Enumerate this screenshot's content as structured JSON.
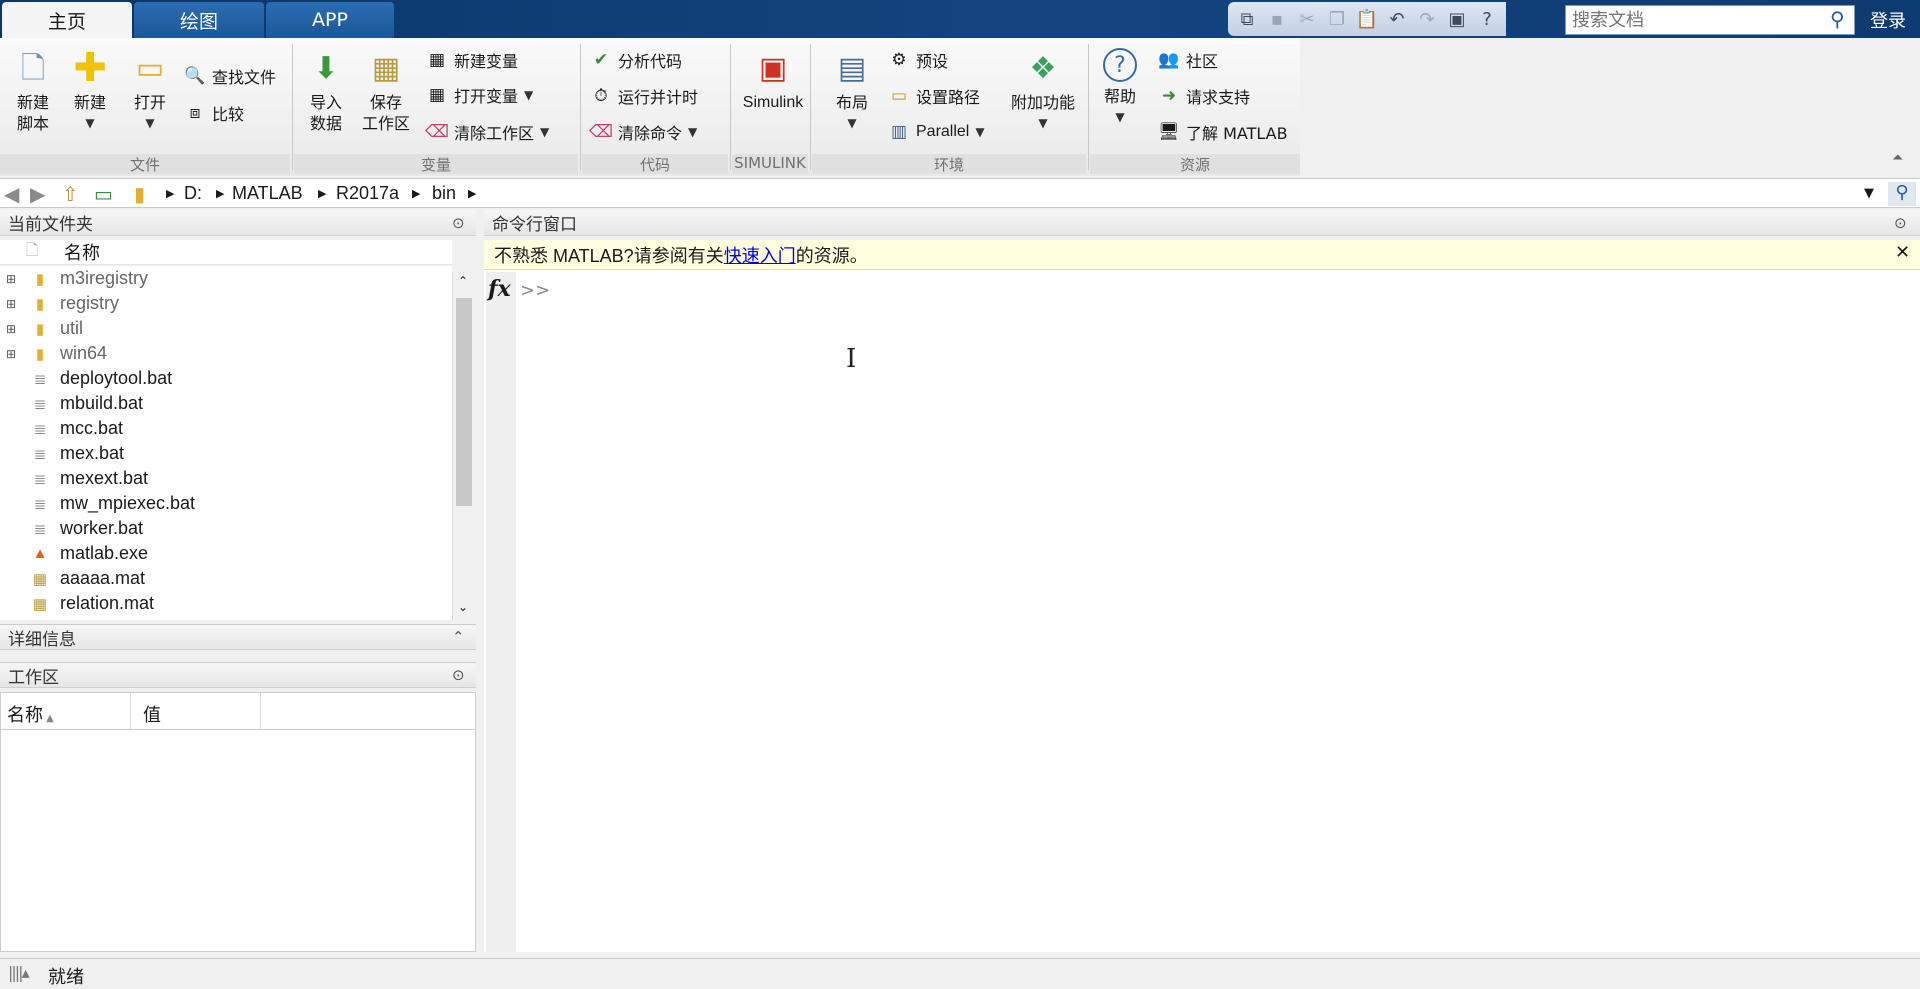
{
  "tabs": [
    {
      "label": "主页"
    },
    {
      "label": "绘图"
    },
    {
      "label": "APP"
    }
  ],
  "search": {
    "placeholder": "搜索文档"
  },
  "login_label": "登录",
  "ribbon": {
    "file": {
      "new_script": "新建\n脚本",
      "new": "新建",
      "open": "打开",
      "find_files": "查找文件",
      "compare": "比较",
      "group": "文件"
    },
    "variable": {
      "import": "导入\n数据",
      "save_ws": "保存\n工作区",
      "new_var": "新建变量",
      "open_var": "打开变量",
      "clear_ws": "清除工作区",
      "group": "变量"
    },
    "code": {
      "analyze": "分析代码",
      "run_time": "运行并计时",
      "clear_cmd": "清除命令",
      "group": "代码"
    },
    "simulink": {
      "label": "Simulink",
      "group": "SIMULINK"
    },
    "env": {
      "layout": "布局",
      "prefs": "预设",
      "set_path": "设置路径",
      "parallel": "Parallel",
      "addons": "附加功能",
      "group": "环境"
    },
    "resources": {
      "help": "帮助",
      "community": "社区",
      "request_support": "请求支持",
      "learn": "了解 MATLAB",
      "group": "资源"
    }
  },
  "path": [
    "D:",
    "MATLAB",
    "R2017a",
    "bin"
  ],
  "current_folder": {
    "title": "当前文件夹",
    "col_name": "名称",
    "items": [
      {
        "name": "m3iregistry",
        "type": "folder"
      },
      {
        "name": "registry",
        "type": "folder"
      },
      {
        "name": "util",
        "type": "folder"
      },
      {
        "name": "win64",
        "type": "folder"
      },
      {
        "name": "deploytool.bat",
        "type": "bat"
      },
      {
        "name": "mbuild.bat",
        "type": "bat"
      },
      {
        "name": "mcc.bat",
        "type": "bat"
      },
      {
        "name": "mex.bat",
        "type": "bat"
      },
      {
        "name": "mexext.bat",
        "type": "bat"
      },
      {
        "name": "mw_mpiexec.bat",
        "type": "bat"
      },
      {
        "name": "worker.bat",
        "type": "bat"
      },
      {
        "name": "matlab.exe",
        "type": "exe"
      },
      {
        "name": "aaaaa.mat",
        "type": "mat"
      },
      {
        "name": "relation.mat",
        "type": "mat"
      }
    ]
  },
  "details": {
    "title": "详细信息"
  },
  "workspace": {
    "title": "工作区",
    "col_name": "名称",
    "col_value": "值"
  },
  "command_window": {
    "title": "命令行窗口",
    "notice_prefix": "不熟悉 MATLAB?请参阅有关",
    "notice_link": "快速入门",
    "notice_suffix": "的资源。",
    "fx": "fx",
    "prompt": ">>"
  },
  "status": {
    "text": "就绪"
  }
}
